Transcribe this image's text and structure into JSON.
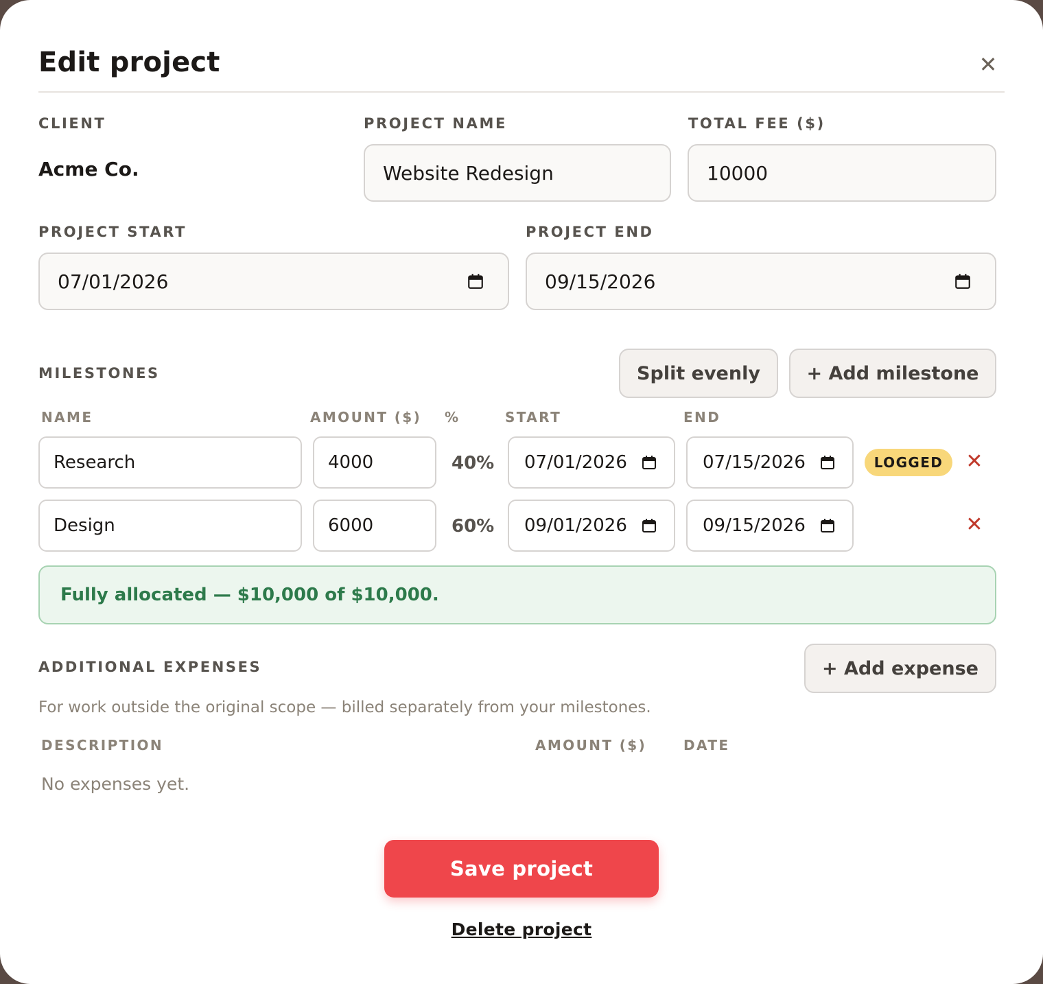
{
  "modal": {
    "title": "Edit project",
    "close_icon": "close-icon"
  },
  "client": {
    "label": "CLIENT",
    "value": "Acme Co."
  },
  "project_name": {
    "label": "PROJECT NAME",
    "value": "Website Redesign"
  },
  "total_fee": {
    "label": "TOTAL FEE ($)",
    "value": "10000"
  },
  "project_start": {
    "label": "PROJECT START",
    "value": "07/01/2026"
  },
  "project_end": {
    "label": "PROJECT END",
    "value": "09/15/2026"
  },
  "milestones": {
    "label": "MILESTONES",
    "split_button": "Split evenly",
    "add_button": "+ Add milestone",
    "columns": {
      "name": "NAME",
      "amount": "AMOUNT ($)",
      "percent": "%",
      "start": "START",
      "end": "END"
    },
    "rows": [
      {
        "name": "Research",
        "amount": "4000",
        "percent": "40%",
        "start": "07/01/2026",
        "end": "07/15/2026",
        "badge": "LOGGED"
      },
      {
        "name": "Design",
        "amount": "6000",
        "percent": "60%",
        "start": "09/01/2026",
        "end": "09/15/2026",
        "badge": ""
      }
    ],
    "allocation_message": "Fully allocated — $10,000 of $10,000."
  },
  "expenses": {
    "label": "ADDITIONAL EXPENSES",
    "add_button": "+ Add expense",
    "hint": "For work outside the original scope — billed separately from your milestones.",
    "columns": {
      "description": "DESCRIPTION",
      "amount": "AMOUNT ($)",
      "date": "DATE"
    },
    "empty_text": "No expenses yet."
  },
  "actions": {
    "save": "Save project",
    "delete": "Delete project"
  },
  "colors": {
    "accent": "#ef464b",
    "success": "#2d7a4b",
    "badge": "#f8d77a",
    "remove": "#c0392b"
  }
}
